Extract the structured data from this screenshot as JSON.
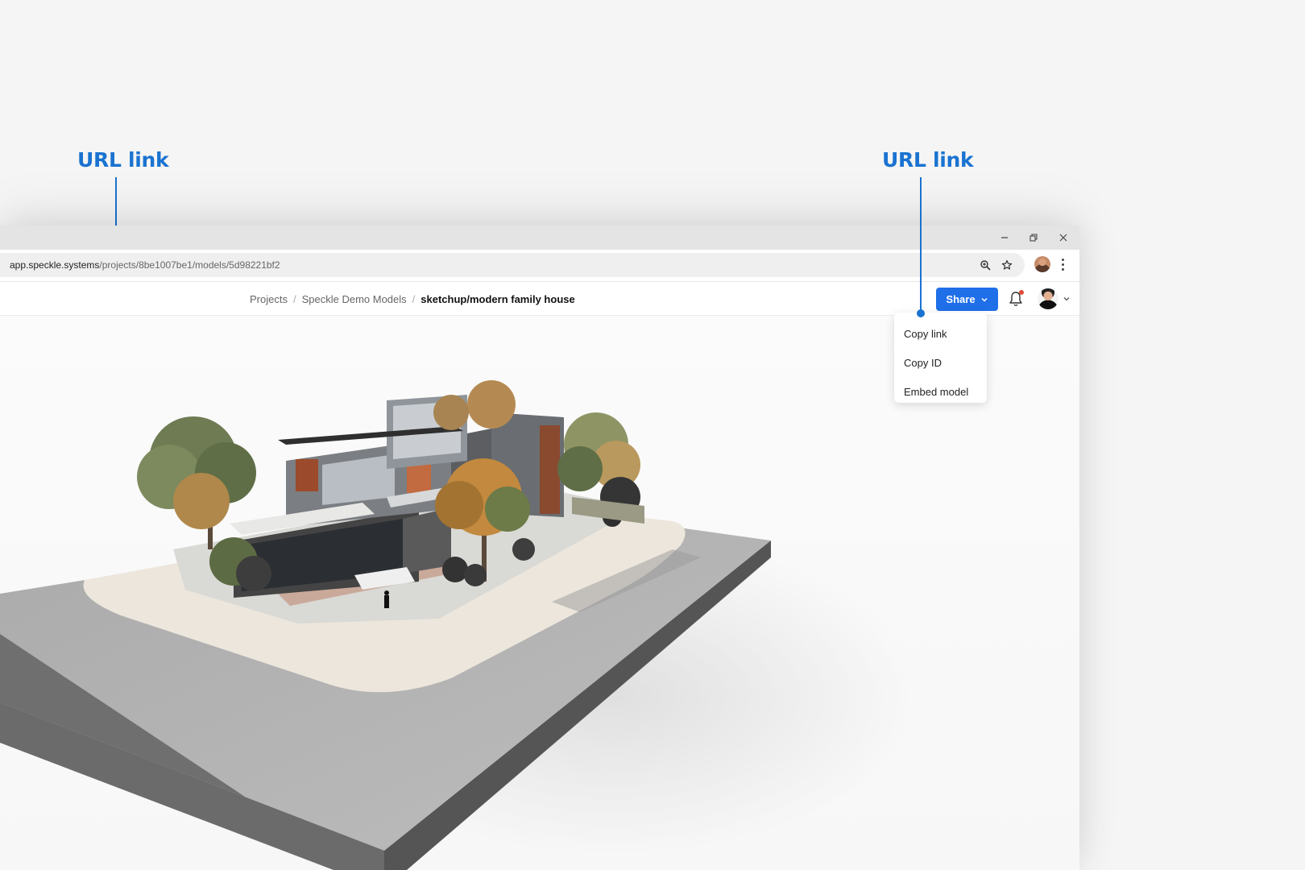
{
  "callouts": {
    "left_label": "URL link",
    "right_label": "URL link"
  },
  "browser": {
    "url_host": "app.speckle.systems",
    "url_path": "/projects/8be1007be1/models/5d98221bf2",
    "icons": [
      "zoom-icon",
      "star-icon",
      "kebab-menu-icon",
      "minimize-icon",
      "restore-icon",
      "close-icon"
    ]
  },
  "appbar": {
    "breadcrumb": {
      "projects": "Projects",
      "sep1": "/",
      "project": "Speckle Demo Models",
      "sep2": "/",
      "model": "sketchup/modern family house"
    },
    "share_label": "Share"
  },
  "share_menu": {
    "items": [
      "Copy link",
      "Copy ID",
      "Embed model"
    ]
  },
  "colors": {
    "accent": "#1a73d0",
    "share_button": "#1f6fe8",
    "notification_dot": "#e04b3a"
  }
}
